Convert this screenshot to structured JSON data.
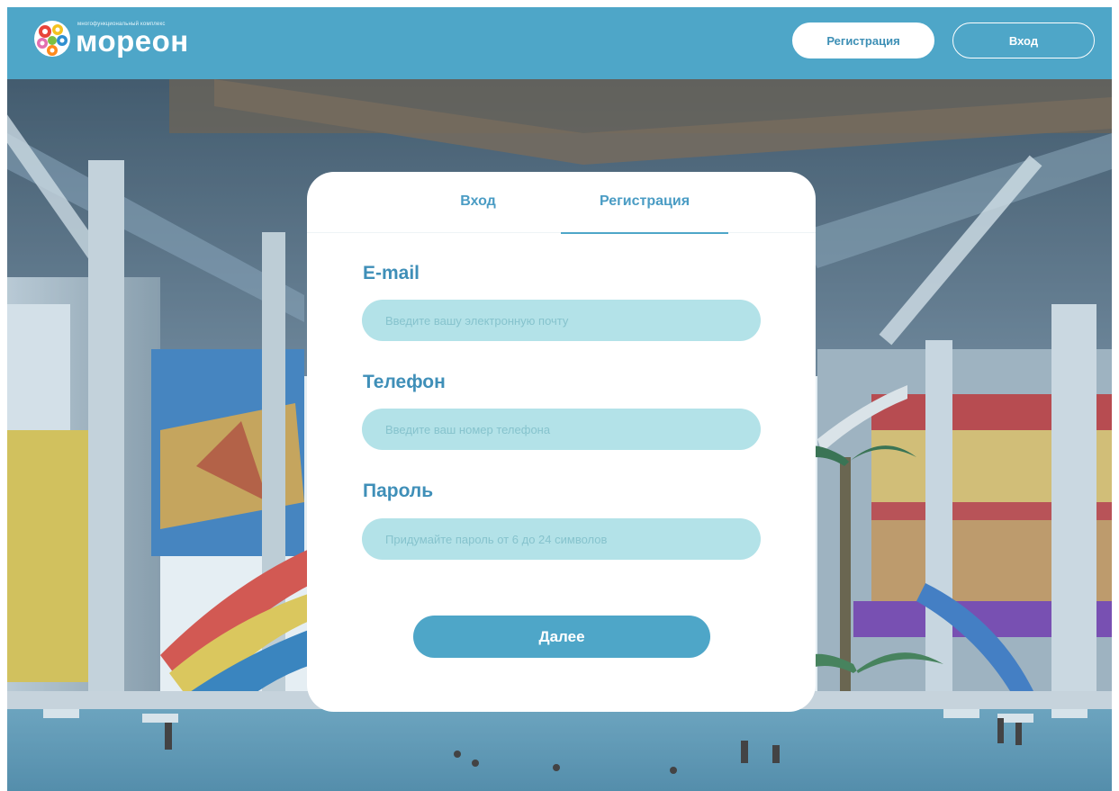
{
  "header": {
    "logo_tagline": "многофункциональный комплекс",
    "logo_word": "мореон",
    "register_label": "Регистрация",
    "login_label": "Вход"
  },
  "card": {
    "tabs": [
      {
        "label": "Вход",
        "active": false
      },
      {
        "label": "Регистрация",
        "active": true
      }
    ],
    "fields": {
      "email": {
        "label": "E-mail",
        "placeholder": "Введите вашу электронную почту",
        "value": ""
      },
      "phone": {
        "label": "Телефон",
        "placeholder": "Введите ваш номер телефона",
        "value": ""
      },
      "password": {
        "label": "Пароль",
        "placeholder": "Придумайте пароль от 6 до 24 символов",
        "value": ""
      }
    },
    "next_label": "Далее"
  },
  "colors": {
    "brand": "#4ea6c8",
    "input_bg": "#b3e2e8",
    "label": "#3f8fb8"
  }
}
